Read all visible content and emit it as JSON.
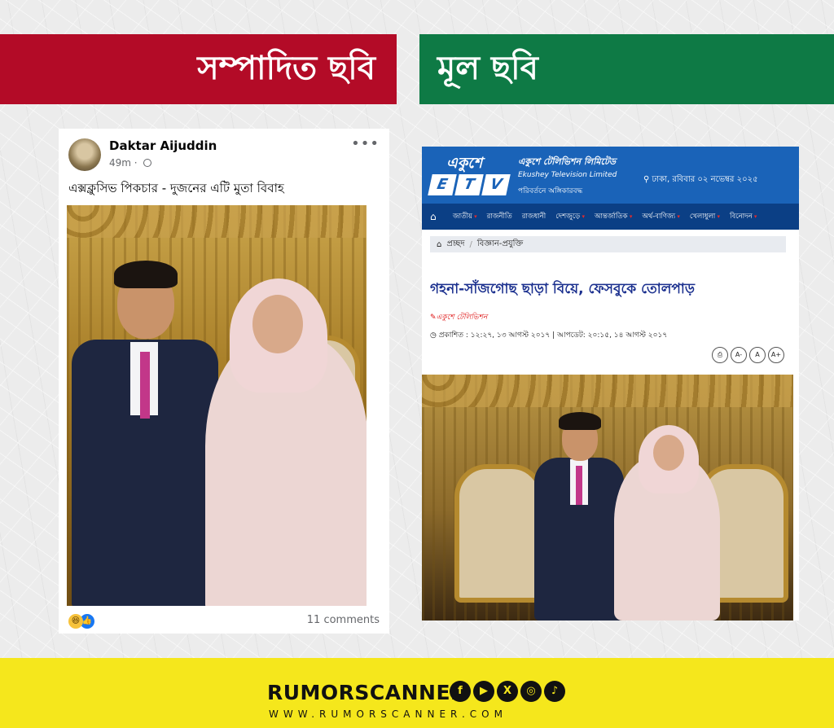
{
  "banners": {
    "left_title": "সম্পাদিত ছবি",
    "right_title": "মূল ছবি"
  },
  "facebook_post": {
    "author": "Daktar Aijuddin",
    "time": "49m ·",
    "caption": "এক্সক্লুসিভ পিকচার - দুজনের এটি মুতা বিবাহ",
    "more_icon": "more-horizontal-icon",
    "reactions": [
      "haha",
      "like"
    ],
    "comments": "11 comments"
  },
  "etv": {
    "logo_bn": "একুশে",
    "logo_letters": [
      "E",
      "T",
      "V"
    ],
    "brand_bn": "একুশে টেলিভিশন লিমিটেড",
    "brand_en": "Ekushey Television Limited",
    "brand_tagline": "পরিবর্তনে অঙ্গিকারবদ্ধ",
    "location_date": "ঢাকা, রবিবার   ০২ নভেম্বর ২০২৫",
    "nav": [
      "জাতীয়",
      "রাজনীতি",
      "রাজধানী",
      "দেশজুড়ে",
      "আন্তর্জাতিক",
      "অর্থ-বাণিজ্য",
      "খেলাধুলা",
      "বিনোদন"
    ],
    "breadcrumb": [
      "প্রচ্ছদ",
      "বিজ্ঞান-প্রযুক্তি"
    ],
    "headline": "গহনা-সাঁজগোছ ছাড়া বিয়ে, ফেসবুকে তোলপাড়",
    "source": "একুশে টেলিভিশন",
    "meta": "প্রকাশিত : ১২:২৭, ১৩ আগস্ট ২০১৭ | আপডেট: ২০:১৫, ১৪ আগস্ট ২০১৭",
    "tools": [
      "⎙",
      "A-",
      "A",
      "A+"
    ]
  },
  "footer": {
    "brand": "RUMORSCANNER",
    "social_icons": [
      "facebook-icon",
      "youtube-icon",
      "x-icon",
      "instagram-icon",
      "tiktok-icon"
    ],
    "url": "WWW.RUMORSCANNER.COM"
  },
  "colors": {
    "banner_red": "#b30b27",
    "banner_green": "#0e7a45",
    "etv_blue": "#1a63b8",
    "etv_nav": "#0b3f85",
    "footer_yellow": "#f5e71c"
  }
}
